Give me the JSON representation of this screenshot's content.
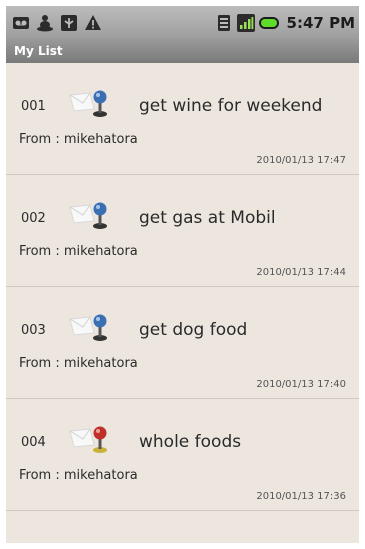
{
  "status_bar": {
    "time": "5:47 PM",
    "left_icons": [
      "voicemail-icon",
      "usb-person-icon",
      "usb-debug-icon",
      "warning-icon"
    ],
    "right_icons": [
      "sim-icon",
      "signal-icon",
      "battery-icon"
    ]
  },
  "title_bar": {
    "title": "My List"
  },
  "list": {
    "items": [
      {
        "number": "001",
        "title": "get wine for weekend",
        "from": "From : mikehatora",
        "date": "2010/01/13 17:47",
        "pin_color": "#3b6fb3"
      },
      {
        "number": "002",
        "title": "get gas at Mobil",
        "from": "From : mikehatora",
        "date": "2010/01/13 17:44",
        "pin_color": "#3b6fb3"
      },
      {
        "number": "003",
        "title": "get dog food",
        "from": "From : mikehatora",
        "date": "2010/01/13 17:40",
        "pin_color": "#3b6fb3"
      },
      {
        "number": "004",
        "title": "whole foods",
        "from": "From : mikehatora",
        "date": "2010/01/13 17:36",
        "pin_color": "#c0302a"
      }
    ]
  }
}
